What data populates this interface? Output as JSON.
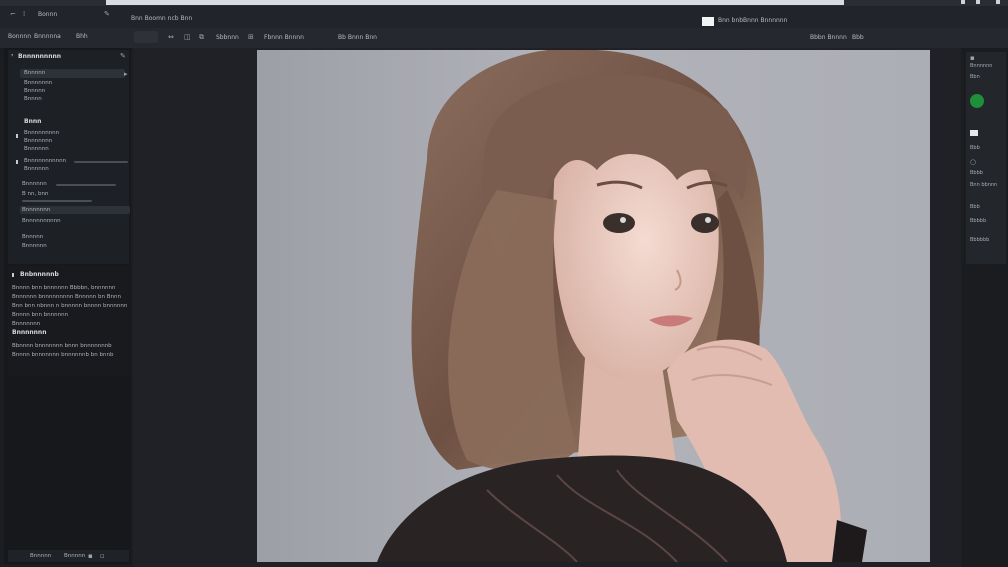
{
  "titlebar": {
    "menu_label": "Bonnn",
    "tab_text": "Bnn Boomn ncb Bnn"
  },
  "toolbar": {
    "left_tabs": [
      "Bonnnn",
      "Bnnnnna",
      "Bhh"
    ],
    "tools": [
      "Sbbnnn",
      "Fbnnn Bnnnn",
      "Bb Bnnn Bnn"
    ],
    "notice_text": "Bnn bnbBnnn Bnnnnnn",
    "right_label": "Bbbn Bnnnn",
    "right_small": "Bbb"
  },
  "left_panel": {
    "sections": [
      {
        "title": "Bnnnnnnnnn",
        "items": [
          "Bnnnnn",
          "Bnnnnnnn",
          "Bnnnnn",
          "Bnnnn"
        ]
      },
      {
        "title": "Bnnn",
        "items": [
          "Bnnnnnnnnn",
          "Bnnnnnnn",
          "Bnnnnnn"
        ]
      },
      {
        "title": "Bnnnnnnnnnnn",
        "items": [
          "Bnnnnnn"
        ]
      }
    ],
    "rows": [
      "Bnnnnnn",
      "B nn, bnn",
      "Bnnnnnnn",
      "Bnnnnnnnnnn",
      "Bnnnnn",
      "Bnnnnnn"
    ],
    "description_title": "Bnbnnnnnb",
    "description_lines": [
      "Bnnnn bnn bnnnnnn Bbbbn, bnnnnnn",
      "Bnnnnnn bnnnnnnnnn Bnnnnn bn Bnnn",
      "Bnn bnn nbnnn n bnnnnn bnnnn bnnnnnn",
      "Bnnnn bnn bnnnnnn",
      "Bnnnnnnn"
    ],
    "description_title_2": "Bnnnnnnn",
    "description_lines_2": [
      "Bbnnnn bnnnnnnn bnnn bnnnnnnnb",
      "Bnnnn bnnnnnnn bnnnnnnb bn bnnb"
    ],
    "footer_items": [
      "Bnnnnn",
      "Bnnnnn"
    ]
  },
  "right_panel": {
    "labels": [
      "Bnnnnnn",
      "Bbn",
      "Bbb",
      "Bbbb",
      "Bnn bbnnn",
      "Bbb",
      "Bbbbb",
      "Bbbbbb"
    ]
  },
  "colors": {
    "accent_green": "#1f8f3a",
    "canvas_bg": "#aaacb3",
    "panel": "#16181c"
  }
}
